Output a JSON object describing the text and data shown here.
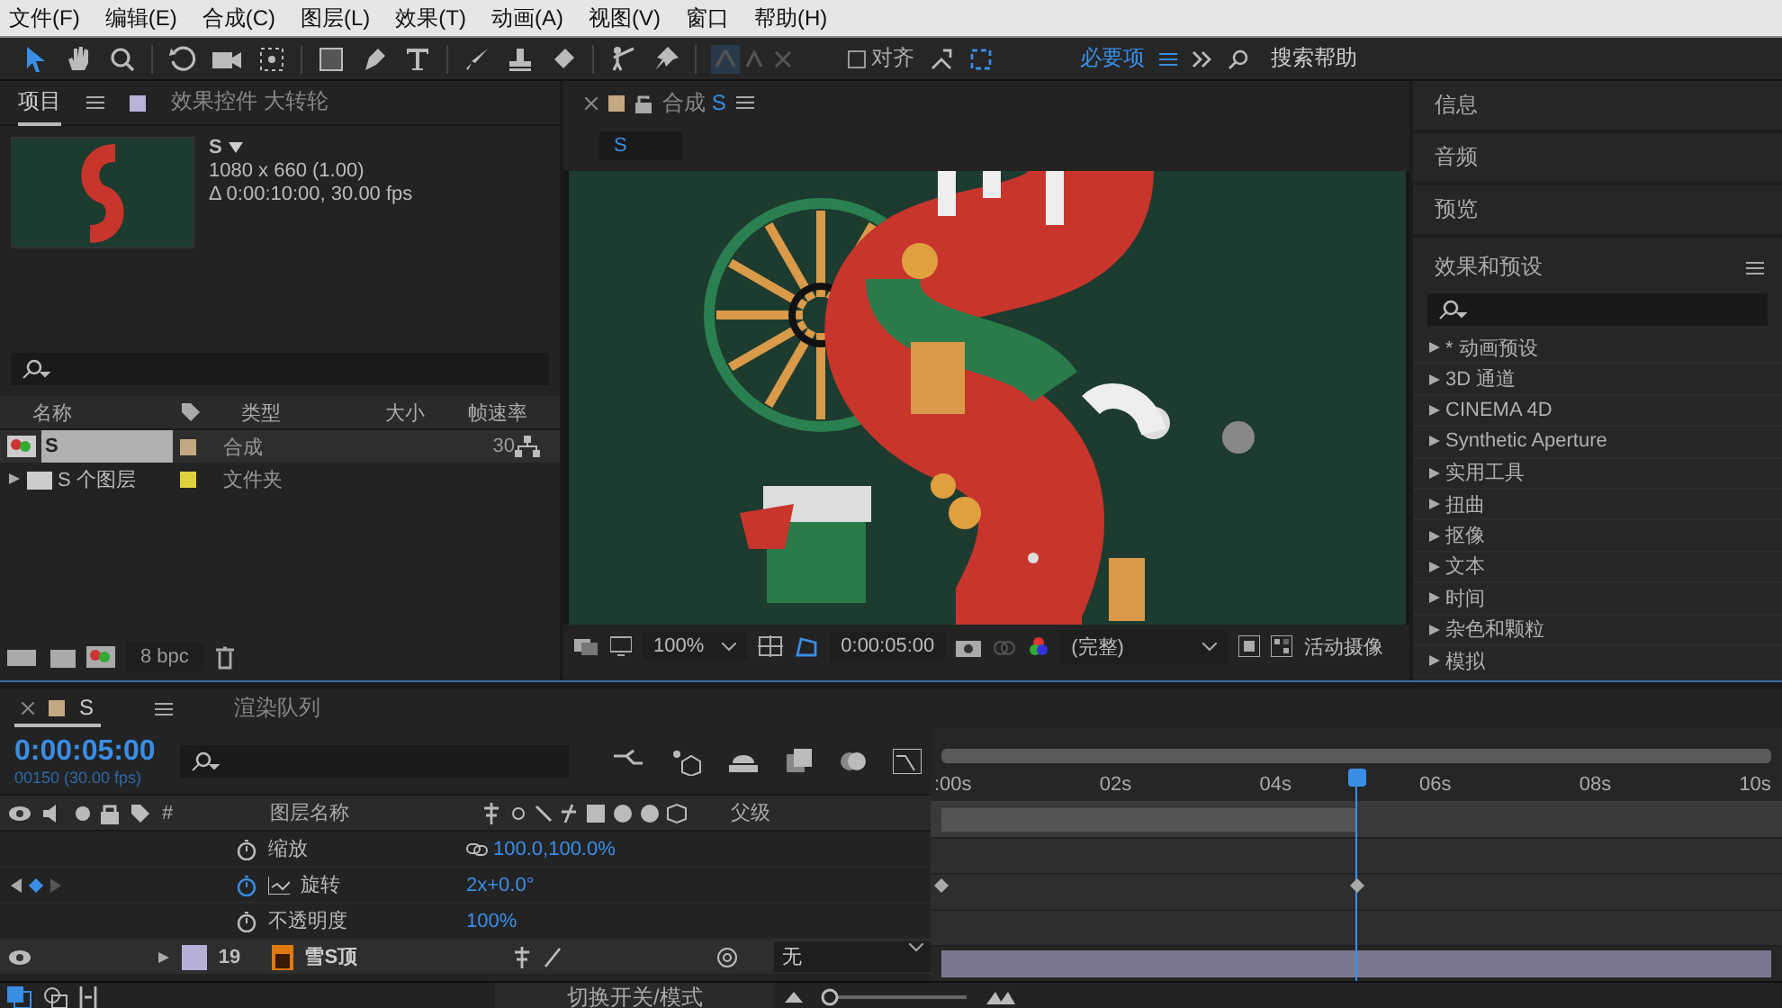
{
  "menu": [
    "文件(F)",
    "编辑(E)",
    "合成(C)",
    "图层(L)",
    "效果(T)",
    "动画(A)",
    "视图(V)",
    "窗口",
    "帮助(H)"
  ],
  "toolbar": {
    "snap": {
      "label": "对齐",
      "checked": false
    },
    "workspace": "必要项",
    "search_help": "搜索帮助"
  },
  "project_panel": {
    "tabs": [
      {
        "label": "项目",
        "selected": true
      },
      {
        "label": "效果控件 大转轮",
        "selected": false
      }
    ],
    "comp_name": "S",
    "comp_size": "1080 x 660 (1.00)",
    "comp_duration": "Δ 0:00:10:00, 30.00 fps",
    "columns": [
      "名称",
      "类型",
      "大小",
      "帧速率"
    ],
    "items": [
      {
        "kind": "composition",
        "name": "S",
        "type": "合成",
        "rate": "30",
        "color": "#c4a882",
        "selected": true
      },
      {
        "kind": "folder",
        "name": "S 个图层",
        "type": "文件夹",
        "color": "#e0d040",
        "selected": false
      }
    ],
    "bit_depth": "8 bpc"
  },
  "composition_panel": {
    "tab_prefix": "合成",
    "tab_name": "S",
    "breadcrumb": "S",
    "zoom": "100%",
    "time": "0:00:05:00",
    "resolution": "(完整)",
    "camera": "活动摄像"
  },
  "right_panels": [
    "信息",
    "音频",
    "预览"
  ],
  "effects_panel": {
    "title": "效果和预设",
    "categories": [
      "* 动画预设",
      "3D 通道",
      "CINEMA 4D",
      "Synthetic Aperture",
      "实用工具",
      "扭曲",
      "抠像",
      "文本",
      "时间",
      "杂色和颗粒",
      "模拟"
    ]
  },
  "timeline": {
    "tabs": [
      {
        "label": "S",
        "selected": true
      },
      {
        "label": "渲染队列",
        "selected": false
      }
    ],
    "current_time": "0:00:05:00",
    "frame_info": "00150 (30.00 fps)",
    "columns": {
      "number": "#",
      "layer_name": "图层名称",
      "parent": "父级"
    },
    "properties": [
      {
        "name": "缩放",
        "value": "100.0,100.0%",
        "animated": false,
        "linked": true
      },
      {
        "name": "旋转",
        "value": "2x+0.0°",
        "animated": true,
        "linked": false
      },
      {
        "name": "不透明度",
        "value": "100%",
        "animated": false,
        "linked": false
      }
    ],
    "layers": [
      {
        "number": "19",
        "name": "雪S顶",
        "parent": "无",
        "color": "#b4b0d8"
      }
    ],
    "ruler": [
      ":00s",
      "02s",
      "04s",
      "06s",
      "08s",
      "10s"
    ],
    "playhead": {
      "level": 0.5
    },
    "toggle_label": "切换开关/模式",
    "zoom_slider": {
      "level": 0.05
    }
  }
}
